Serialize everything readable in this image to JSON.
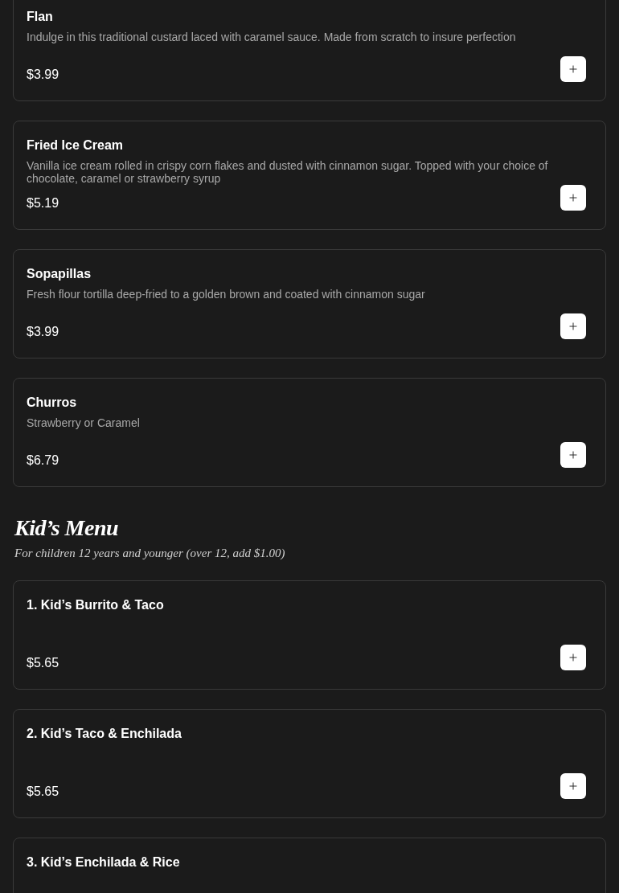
{
  "sections": [
    {
      "items": [
        {
          "name": "Flan",
          "description": "Indulge in this traditional custard laced with caramel sauce. Made from scratch to insure perfection",
          "price": "$3.99"
        },
        {
          "name": "Fried Ice Cream",
          "description": "Vanilla ice cream rolled in crispy corn flakes and dusted with cinnamon sugar. Topped with your choice of chocolate, caramel or strawberry syrup",
          "price": "$5.19"
        },
        {
          "name": "Sopapillas",
          "description": "Fresh flour tortilla deep-fried to a golden brown and coated with cinnamon sugar",
          "price": "$3.99"
        },
        {
          "name": "Churros",
          "description": "Strawberry or Caramel",
          "price": "$6.79"
        }
      ]
    },
    {
      "heading": "Kid’s Menu",
      "subtitle": "For children 12 years and younger (over 12, add $1.00)",
      "items": [
        {
          "name": "1. Kid’s Burrito & Taco",
          "price": "$5.65"
        },
        {
          "name": "2. Kid’s Taco & Enchilada",
          "price": "$5.65"
        },
        {
          "name": "3. Kid’s Enchilada & Rice"
        }
      ]
    }
  ]
}
